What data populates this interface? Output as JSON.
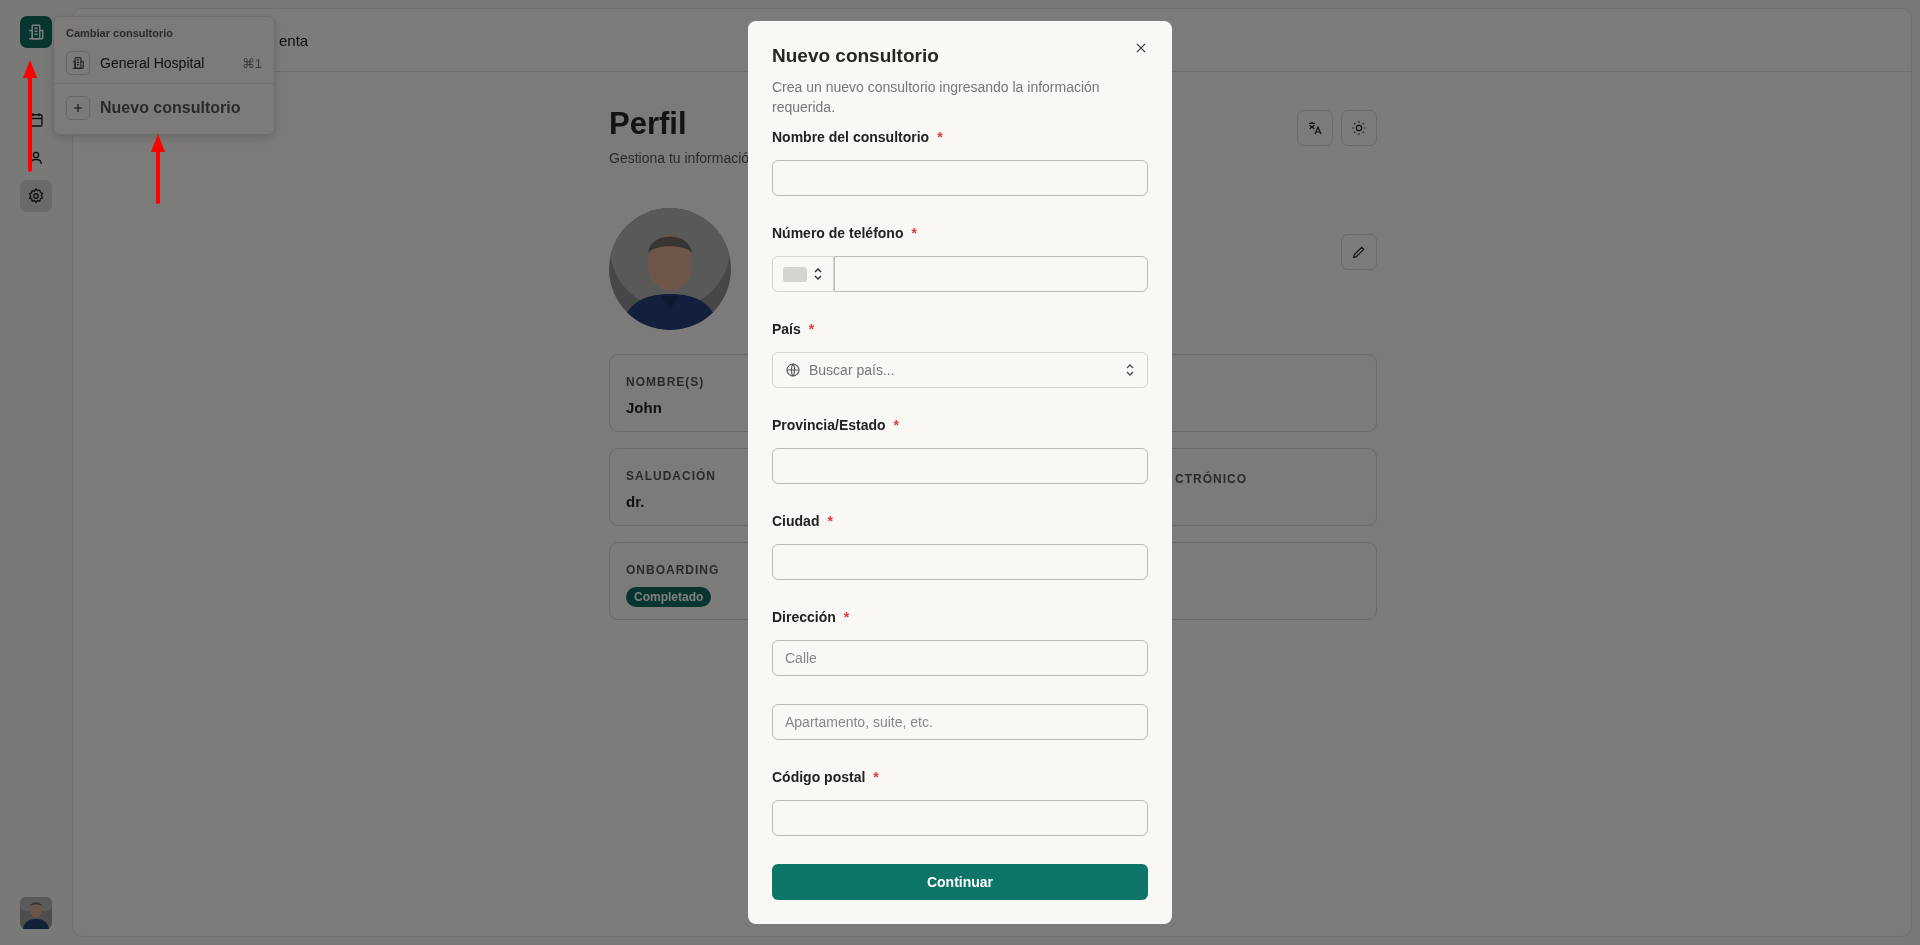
{
  "sidebar": {
    "nav": [
      {
        "kind": "calendar",
        "selected": false
      },
      {
        "kind": "people",
        "selected": false
      },
      {
        "kind": "settings",
        "selected": true
      }
    ]
  },
  "switcher": {
    "header": "Cambiar consultorio",
    "items": [
      {
        "label": "General Hospital",
        "shortcut": "⌘1"
      }
    ],
    "action": "Nuevo consultorio"
  },
  "topbar": {
    "crumb": "enta"
  },
  "profile": {
    "title": "Perfil",
    "subtitle": "Gestiona tu informació",
    "cards": [
      {
        "label": "NOMBRE(S)",
        "value": "John"
      },
      {
        "label": "SALUDACIÓN",
        "value": "dr.",
        "label_2": "CTRÓNICO"
      },
      {
        "label": "ONBOARDING",
        "badge": "Completado"
      }
    ]
  },
  "modal": {
    "title": "Nuevo consultorio",
    "description": "Crea un nuevo consultorio ingresando la información requerida.",
    "fields": [
      {
        "kind": "text",
        "label": "Nombre del consultorio",
        "required": true
      },
      {
        "kind": "phone",
        "label": "Número de teléfono",
        "required": true
      },
      {
        "kind": "country",
        "label": "País",
        "required": true,
        "placeholder": "Buscar país..."
      },
      {
        "kind": "text",
        "label": "Provincia/Estado",
        "required": true
      },
      {
        "kind": "text",
        "label": "Ciudad",
        "required": true
      },
      {
        "kind": "address",
        "label": "Dirección",
        "required": true,
        "placeholders": [
          "Calle",
          "Apartamento, suite, etc."
        ]
      },
      {
        "kind": "text",
        "label": "Código postal",
        "required": true
      }
    ],
    "required_mark": "*",
    "submit": "Continuar"
  }
}
